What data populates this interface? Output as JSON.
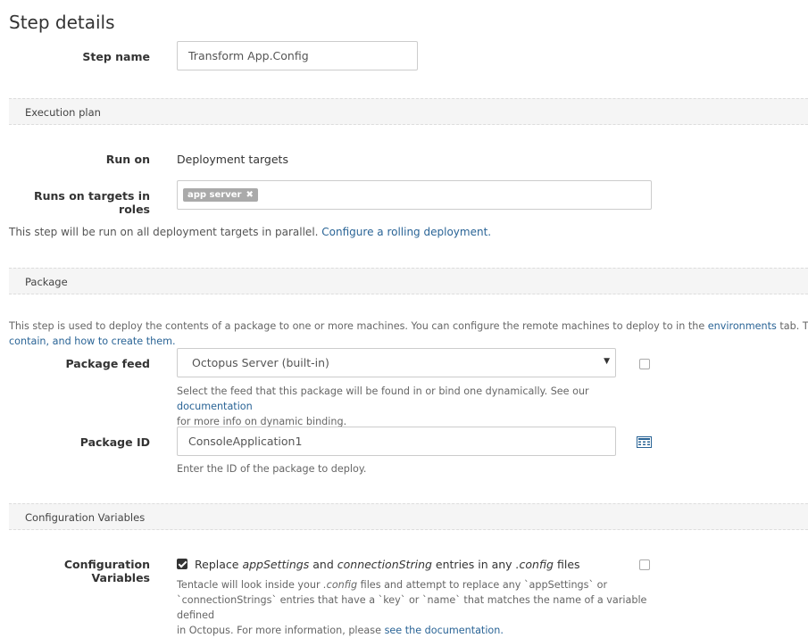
{
  "page": {
    "title": "Step details"
  },
  "step_name": {
    "label": "Step name",
    "value": "Transform App.Config"
  },
  "execution_plan": {
    "section_title": "Execution plan",
    "run_on_label": "Run on",
    "run_on_value": "Deployment targets",
    "roles_label": "Runs on targets in roles",
    "roles": [
      {
        "name": "app server",
        "remove_icon": "close-icon"
      }
    ],
    "parallel_note": "This step will be run on all deployment targets in parallel.",
    "rolling_link": "Configure a rolling deployment."
  },
  "package": {
    "section_title": "Package",
    "intro_text": "This step is used to deploy the contents of a package to one or more machines. You can configure the remote machines to deploy to in the",
    "environments_link": "environments",
    "intro_text_2": "tab. The packag",
    "intro_line2_link": "contain, and how to create them.",
    "feed_label": "Package feed",
    "feed_value": "Octopus Server (built-in)",
    "feed_help": "Select the feed that this package will be found in or bind one dynamically. See our",
    "feed_help_link": "documentation",
    "feed_help_2": "for more info on dynamic binding.",
    "id_label": "Package ID",
    "id_value": "ConsoleApplication1",
    "id_help": "Enter the ID of the package to deploy."
  },
  "config_vars": {
    "section_title": "Configuration Variables",
    "label": "Configuration Variables",
    "checkbox_checked": true,
    "replace_pre": "Replace",
    "replace_em1": "appSettings",
    "replace_and": "and",
    "replace_em2": "connectionString",
    "replace_mid": "entries in any",
    "replace_em3": ".config",
    "replace_post": "files",
    "help_line1_pre": "Tentacle will look inside your",
    "help_line1_em": ".config",
    "help_line1_post": "files and attempt to replace any `appSettings` or",
    "help_line2": "`connectionStrings` entries that have a `key` or `name` that matches the name of a variable defined",
    "help_line3": "in Octopus. For more information, please",
    "help_link": "see the documentation."
  }
}
